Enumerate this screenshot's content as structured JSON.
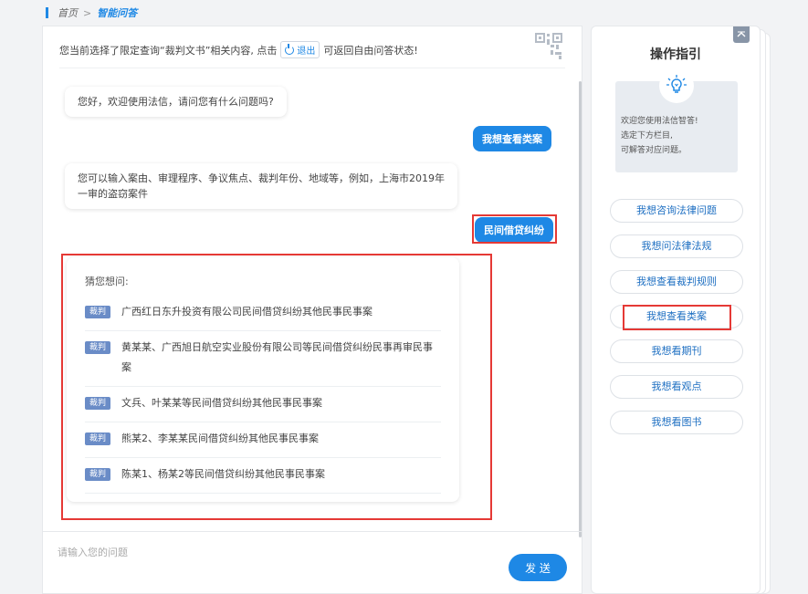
{
  "breadcrumb": {
    "home": "首页",
    "separator": ">",
    "current": "智能问答"
  },
  "notice": {
    "text_before": "您当前选择了限定查询“裁判文书”相关内容, 点击",
    "exit_label": "退出",
    "text_after": "可返回自由问答状态!"
  },
  "chat": {
    "greeting": "您好，欢迎使用法信，请问您有什么问题吗?",
    "user_msg_1": "我想查看类案",
    "bot_reply": "您可以输入案由、审理程序、争议焦点、裁判年份、地域等，例如，上海市2019年一审的盗窃案件",
    "user_msg_2": "民间借贷纠纷"
  },
  "suggestions": {
    "header": "猜您想问:",
    "tag": "裁判",
    "items": [
      "广西红日东升投资有限公司民间借贷纠纷其他民事民事案",
      "黄某某、广西旭日航空实业股份有限公司等民间借贷纠纷民事再审民事案",
      "文兵、叶某某等民间借贷纠纷其他民事民事案",
      "熊某2、李某某民间借贷纠纷其他民事民事案",
      "陈某1、杨某2等民间借贷纠纷其他民事民事案"
    ]
  },
  "input": {
    "placeholder": "请输入您的问题",
    "send_label": "发 送"
  },
  "sidebar": {
    "title": "操作指引",
    "collapse_icon": "chevron-up-icon",
    "tip_lines": [
      "欢迎您使用法信智答!",
      "选定下方栏目,",
      "可解答对应问题。"
    ],
    "options": [
      "我想咨询法律问题",
      "我想问法律法规",
      "我想查看裁判规则",
      "我想查看类案",
      "我想看期刊",
      "我想看观点",
      "我想看图书"
    ]
  },
  "colors": {
    "accent": "#1e88e5",
    "highlight": "#e53935",
    "tag": "#6a8cc7"
  }
}
